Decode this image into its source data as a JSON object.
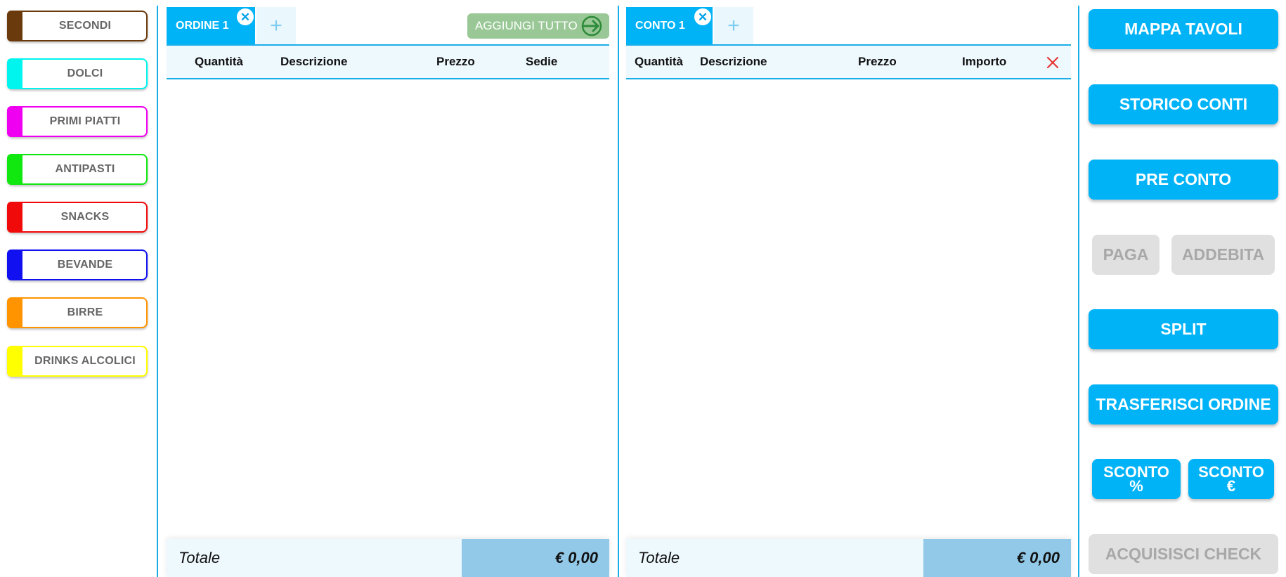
{
  "categories": [
    {
      "label": "SECONDI",
      "color": "#6b3a0c"
    },
    {
      "label": "DOLCI",
      "color": "#00f5ee"
    },
    {
      "label": "PRIMI PIATTI",
      "color": "#f000f0"
    },
    {
      "label": "ANTIPASTI",
      "color": "#10e810"
    },
    {
      "label": "SNACKS",
      "color": "#f00a0a"
    },
    {
      "label": "BEVANDE",
      "color": "#1010f0"
    },
    {
      "label": "BIRRE",
      "color": "#ff9400"
    },
    {
      "label": "DRINKS ALCOLICI",
      "color": "#ffff00"
    }
  ],
  "order_panel": {
    "tab_label": "ORDINE 1",
    "add_all_label": "AGGIUNGI TUTTO",
    "columns": [
      "Quantità",
      "Descrizione",
      "Prezzo",
      "Sedie"
    ],
    "total_label": "Totale",
    "total_value": "€ 0,00"
  },
  "bill_panel": {
    "tab_label": "CONTO 1",
    "columns": [
      "Quantità",
      "Descrizione",
      "Prezzo",
      "Importo"
    ],
    "total_label": "Totale",
    "total_value": "€ 0,00"
  },
  "actions": {
    "mappa_tavoli": "MAPPA TAVOLI",
    "storico_conti": "STORICO CONTI",
    "pre_conto": "PRE CONTO",
    "paga": "PAGA",
    "addebita": "ADDEBITA",
    "split": "SPLIT",
    "trasferisci_ordine": "TRASFERISCI ORDINE",
    "sconto_pct_line1": "SCONTO",
    "sconto_pct_line2": "%",
    "sconto_eur_line1": "SCONTO",
    "sconto_eur_line2": "€",
    "acquisisci_check": "ACQUISISCI CHECK"
  },
  "colors": {
    "accent": "#00b3f7",
    "disabled": "#e0e0e0",
    "add_all": "#99c896",
    "delete": "#e53935"
  }
}
